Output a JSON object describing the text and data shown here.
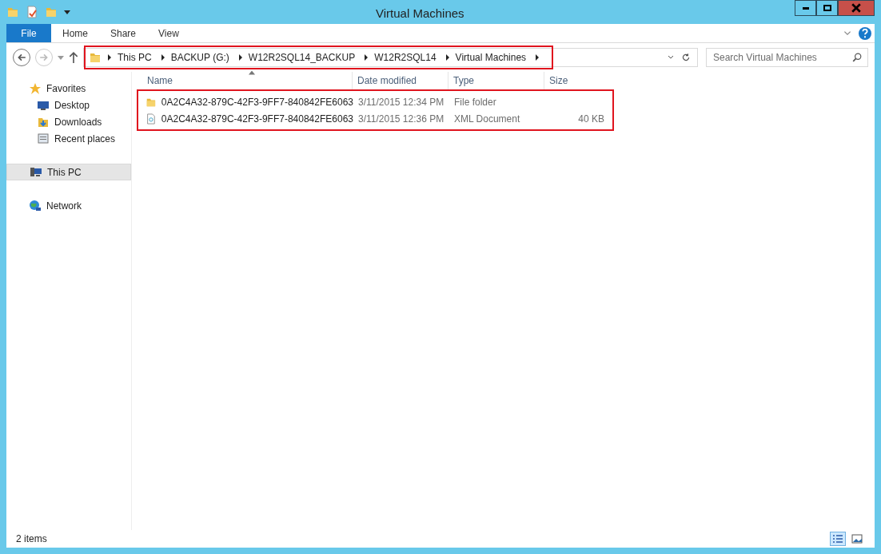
{
  "window": {
    "title": "Virtual Machines"
  },
  "ribbon_tabs": [
    {
      "label": "File",
      "kind": "file"
    },
    {
      "label": "Home",
      "kind": "tab"
    },
    {
      "label": "Share",
      "kind": "tab"
    },
    {
      "label": "View",
      "kind": "tab"
    }
  ],
  "address_bar": {
    "highlighted": true,
    "crumbs": [
      "This PC",
      "BACKUP (G:)",
      "W12R2SQL14_BACKUP",
      "W12R2SQL14",
      "Virtual Machines"
    ]
  },
  "search": {
    "placeholder": "Search Virtual Machines"
  },
  "sidebar": [
    {
      "label": "Favorites",
      "selected": false,
      "children": [
        {
          "label": "Desktop",
          "selected": false
        },
        {
          "label": "Downloads",
          "selected": false
        },
        {
          "label": "Recent places",
          "selected": false
        }
      ]
    },
    {
      "label": "This PC",
      "selected": true
    },
    {
      "label": "Network",
      "selected": false
    }
  ],
  "file_list": {
    "highlighted": true,
    "columns": [
      "Name",
      "Date modified",
      "Type",
      "Size"
    ],
    "rows": [
      {
        "kind": "folder",
        "name": "0A2C4A32-879C-42F3-9FF7-840842FE6063",
        "date": "3/11/2015 12:34 PM",
        "type": "File folder"
      },
      {
        "kind": "xml",
        "name": "0A2C4A32-879C-42F3-9FF7-840842FE6063",
        "date": "3/11/2015 12:36 PM",
        "type": "XML Document",
        "size": "40 KB"
      }
    ]
  },
  "status_bar": {
    "count": "2 items",
    "view_buttons": [
      {
        "kind": "details",
        "selected": true
      },
      {
        "kind": "preview",
        "selected": false
      }
    ]
  }
}
